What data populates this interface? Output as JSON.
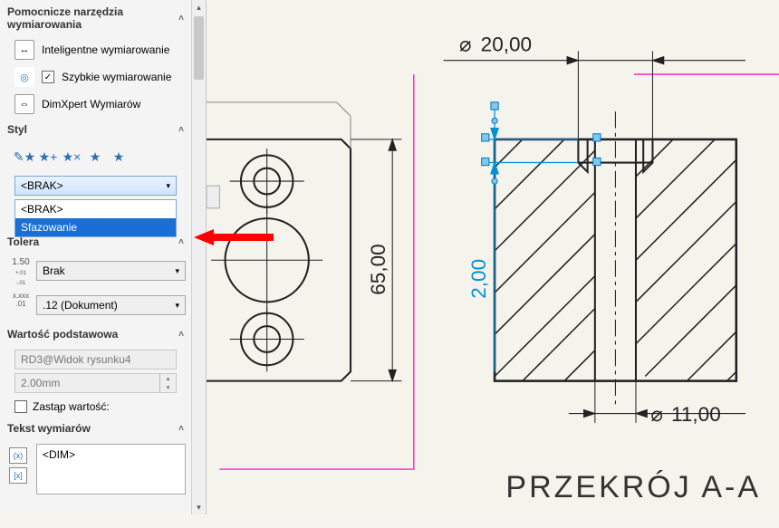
{
  "panel": {
    "dim_tools_header": "Pomocnicze narzędzia wymiarowania",
    "items": [
      {
        "label": "Inteligentne wymiarowanie"
      },
      {
        "label": "Szybkie wymiarowanie",
        "checked": true
      },
      {
        "label": "DimXpert Wymiarów"
      }
    ],
    "style_header": "Styl",
    "style_selected": "<BRAK>",
    "style_options": [
      "<BRAK>",
      "Sfazowanie"
    ],
    "tolerance_header": "Tolerancja/Dokładność",
    "tolerance_header_short": "Tolera",
    "tolerance_type": "Brak",
    "precision": ".12 (Dokument)",
    "baseval_header": "Wartość podstawowa",
    "baseval_ref": "RD3@Widok rysunku4",
    "baseval_val": "2.00mm",
    "override_label": "Zastąp wartość:",
    "dimtext_header": "Tekst wymiarów",
    "dimtext_value": "<DIM>"
  },
  "canvas": {
    "dim_top": "20,00",
    "dim_side_big": "65,00",
    "dim_small_v": "2,00",
    "dim_bottom": "11,00",
    "section_label": "PRZEKRÓJ  A-A",
    "diameter_sym": "⌀"
  }
}
